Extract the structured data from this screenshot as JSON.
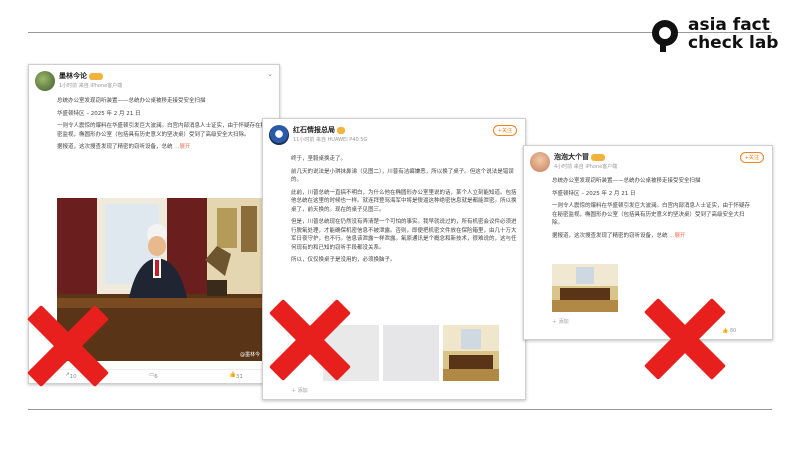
{
  "brand": {
    "line1": "asia fact",
    "line2": "check lab",
    "accent": "#111111"
  },
  "colors": {
    "x_mark": "#e8201d",
    "weibo_orange": "#eb7350",
    "follow": "#f58220"
  },
  "post1": {
    "username": "墨林今论",
    "meta": "1小时前  来自 iPhone客户端",
    "body": [
      "总统办公室发现窃听装置——总统办公桌被移走接受安全扫描",
      "华盛顿特区 – 2025 年 2 月 21 日",
      "一则令人震惊的爆料在华盛顿引发巨大波澜。白宫内部消息人士证实，由于怀疑存在秘密监视，椭圆形办公室（包括具有历史意义的坚决桌）受到了高级安全大扫除。",
      "据报道，这次搜查发现了精密的窃听设备，总统"
    ],
    "more": "...展开",
    "watermark": "@墨林今",
    "counts": {
      "shares": "10",
      "comments": "6",
      "likes": "31"
    }
  },
  "post2": {
    "username": "红石情报总局",
    "meta": "11小时前  来自 HUAWEI P40 5G",
    "follow_label": "+关注",
    "body": [
      "终于，坚毅桌换走了。",
      "前几天的说法是小琪抹鼻涕（见图二），川普有洁癖嫌恶，所以换了桌子。但这个说法是错误的。",
      "此前，川普总统一直搞不明白，为什么他在椭圆形办公室里说的话，某个人立刻能知道。包括他总统在这里的时候也一样。就连拜登骂海军中将是傻逼这种绝密信息就是都能泄密。所以换桌了，前天换的。现在的桌子见图三。",
      "但是，川普总统现在仍然没有弄清楚一个可怕的事实。我早就说过的，所有机密会议件必须进行脱氧处理，才能确保机密信息不被泄露。否则，即便把机密文件放在保险箱里，由几十万大军日夜守护，也不行。信息该泄露一样泄露。氧原通讯是个概念和新技术，很难说的，这与任何现有的和已知的窃听手段都没关系。",
      "所以，仅仅换桌子是没用的，必须换脑子。"
    ],
    "add_label": "添加"
  },
  "post3": {
    "username": "泡泡大个冒",
    "meta": "4小时前  来自 iPhone客户端",
    "follow_label": "+关注",
    "body": [
      "总统办公室发现窃听装置——总统办公桌被移走接受安全扫描",
      "华盛顿特区 – 2025 年 2 月 21 日",
      "一则令人震惊的爆料在华盛顿引发巨大波澜。白宫内部消息人士证实，由于怀疑存在秘密监视，椭圆形办公室（包括具有历史意义的坚决桌）受到了高级安全大扫除。",
      "据报道，这次搜查发现了精密的窃听设备，总统"
    ],
    "more": "...展开",
    "add_label": "添加",
    "counts": {
      "likes": "80"
    }
  }
}
